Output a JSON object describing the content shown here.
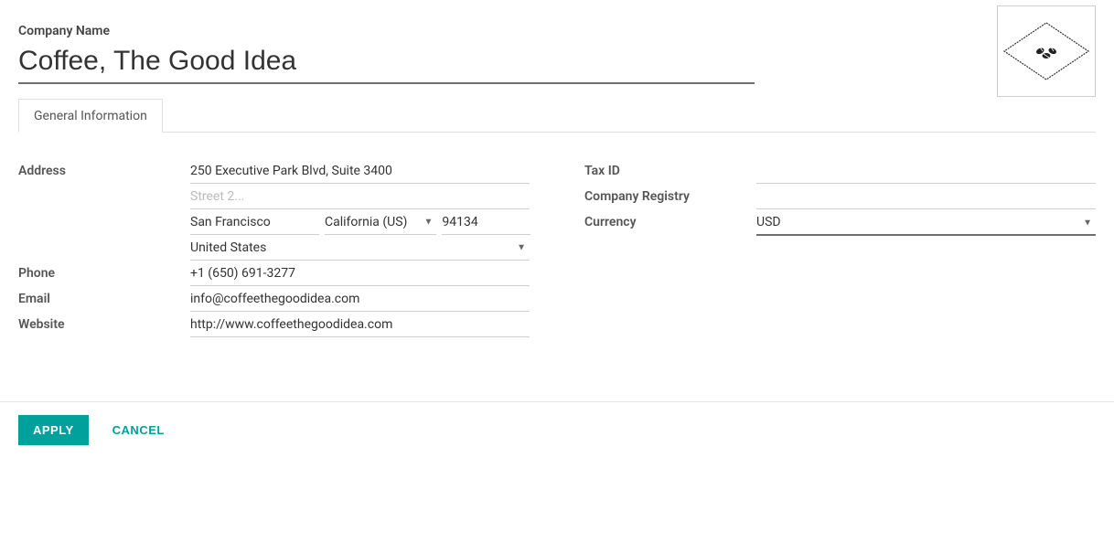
{
  "header": {
    "company_name_label": "Company Name",
    "company_name_value": "Coffee, The Good Idea"
  },
  "tabs": {
    "general_info": "General Information"
  },
  "labels": {
    "address": "Address",
    "phone": "Phone",
    "email": "Email",
    "website": "Website",
    "tax_id": "Tax ID",
    "company_registry": "Company Registry",
    "currency": "Currency"
  },
  "address": {
    "street1": "250 Executive Park Blvd, Suite 3400",
    "street2_placeholder": "Street 2...",
    "street2": "",
    "city": "San Francisco",
    "state": "California (US)",
    "zip": "94134",
    "country": "United States"
  },
  "contact": {
    "phone": "+1 (650) 691-3277",
    "email": "info@coffeethegoodidea.com",
    "website": "http://www.coffeethegoodidea.com"
  },
  "right": {
    "tax_id": "",
    "company_registry": "",
    "currency": "USD"
  },
  "footer": {
    "apply": "APPLY",
    "cancel": "CANCEL"
  },
  "logo": {
    "semantic": "coffee-beans-diamond-logo"
  }
}
